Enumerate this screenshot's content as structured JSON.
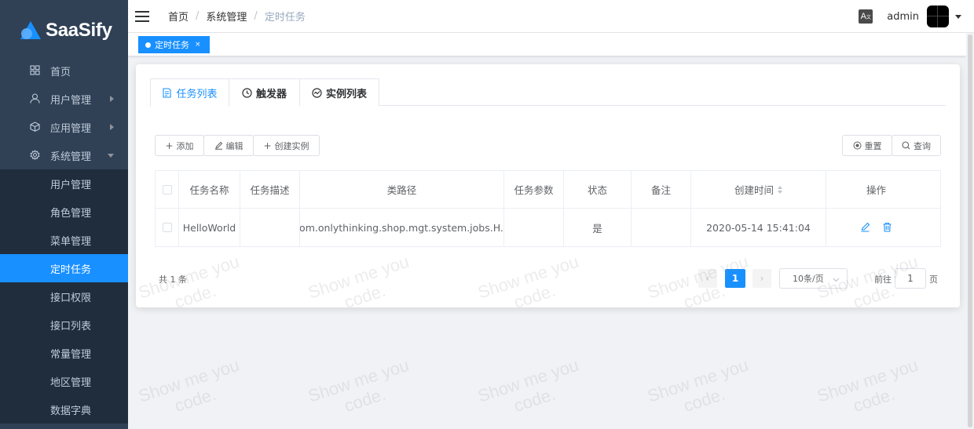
{
  "sidebar": {
    "logo_text": "SaaSify",
    "items": [
      {
        "label": "首页",
        "icon": "grid-icon"
      },
      {
        "label": "用户管理",
        "icon": "user-icon"
      },
      {
        "label": "应用管理",
        "icon": "cube-icon"
      },
      {
        "label": "系统管理",
        "icon": "gear-icon"
      }
    ],
    "sub_items": [
      {
        "label": "用户管理"
      },
      {
        "label": "角色管理"
      },
      {
        "label": "菜单管理"
      },
      {
        "label": "定时任务",
        "active": true
      },
      {
        "label": "接口权限"
      },
      {
        "label": "接口列表"
      },
      {
        "label": "常量管理"
      },
      {
        "label": "地区管理"
      },
      {
        "label": "数据字典"
      }
    ]
  },
  "header": {
    "breadcrumb": [
      "首页",
      "系统管理",
      "定时任务"
    ],
    "lang_icon": "A",
    "username": "admin"
  },
  "tagsview": {
    "active_tag": "定时任务",
    "close": "×"
  },
  "tabs": [
    {
      "label": "任务列表",
      "icon": "doc-icon",
      "active": true
    },
    {
      "label": "触发器",
      "icon": "clock-icon"
    },
    {
      "label": "实例列表",
      "icon": "chart-icon"
    }
  ],
  "toolbar": {
    "add": "添加",
    "edit": "编辑",
    "create_instance": "创建实例",
    "reset": "重置",
    "query": "查询"
  },
  "table": {
    "columns": [
      "任务名称",
      "任务描述",
      "类路径",
      "任务参数",
      "状态",
      "备注",
      "创建时间",
      "操作"
    ],
    "rows": [
      {
        "name": "HelloWorld",
        "desc": "",
        "class_path": "com.onlythinking.shop.mgt.system.jobs.H...",
        "params": "",
        "status": "是",
        "remark": "",
        "created": "2020-05-14 15:41:04"
      }
    ]
  },
  "pagination": {
    "total": "共 1 条",
    "current_page": "1",
    "page_size": "10条/页",
    "goto_prefix": "前往",
    "goto_value": "1",
    "goto_suffix": "页"
  },
  "watermark": {
    "line1": "Show me you",
    "line2": "code."
  },
  "colors": {
    "sidebar_bg": "#304156",
    "submenu_bg": "#1f2d3d",
    "accent": "#1890ff",
    "page_bg": "#f0f2f5"
  }
}
